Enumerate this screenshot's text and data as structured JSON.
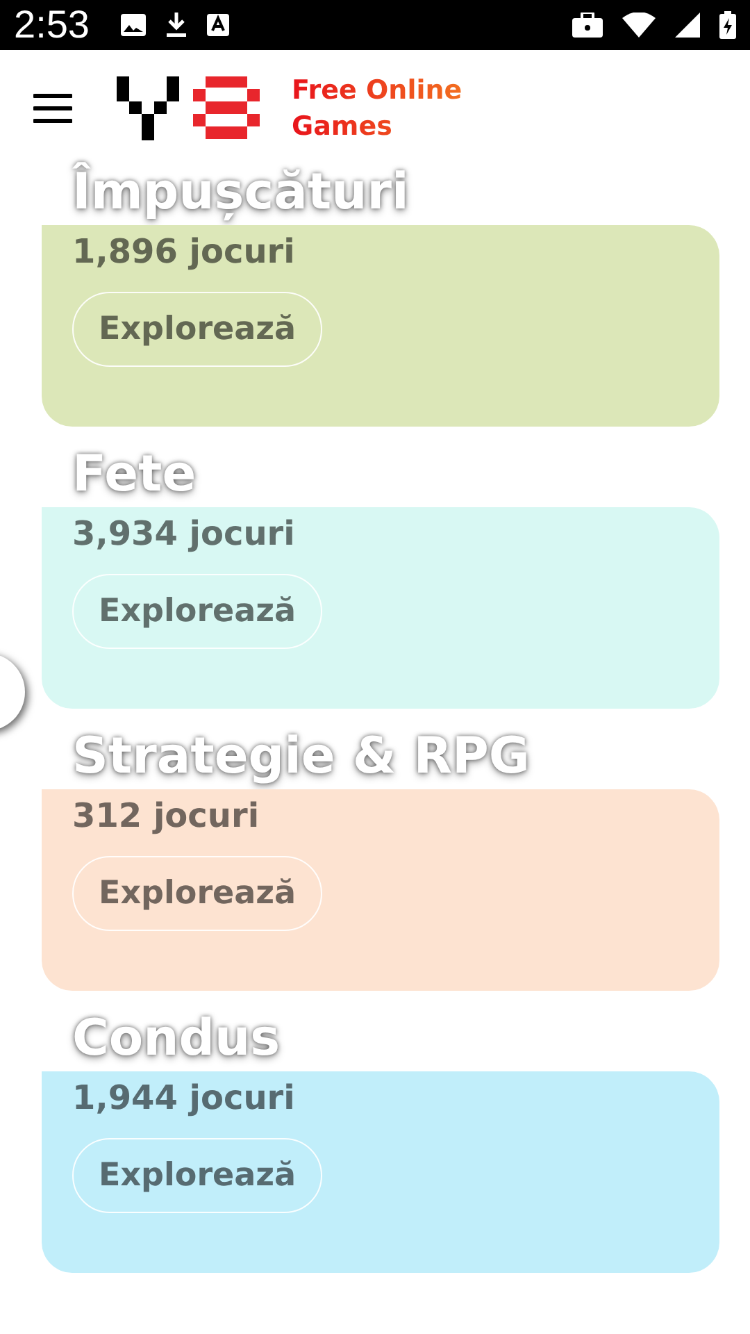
{
  "status_bar": {
    "time": "2:53"
  },
  "header": {
    "logo_text": "Free Online Games"
  },
  "categories": [
    {
      "title": "Împușcături",
      "count": "1,896 jocuri",
      "button": "Explorează",
      "color": "#dce7b8"
    },
    {
      "title": "Fete",
      "count": "3,934 jocuri",
      "button": "Explorează",
      "color": "#d8f8f3"
    },
    {
      "title": "Strategie & RPG",
      "count": "312 jocuri",
      "button": "Explorează",
      "color": "#fde3d1"
    },
    {
      "title": "Condus",
      "count": "1,944 jocuri",
      "button": "Explorează",
      "color": "#c1eefa"
    }
  ]
}
